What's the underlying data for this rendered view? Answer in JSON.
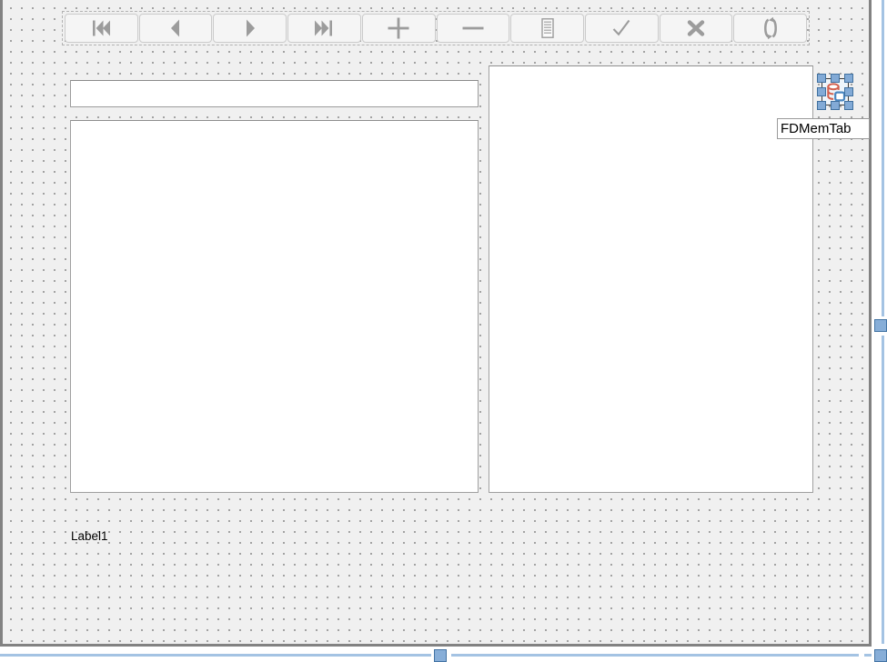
{
  "window": {
    "type": "form-designer"
  },
  "navigator": {
    "buttons": [
      {
        "id": "first",
        "icon": "first-record-icon"
      },
      {
        "id": "prior",
        "icon": "prior-record-icon"
      },
      {
        "id": "next",
        "icon": "next-record-icon"
      },
      {
        "id": "last",
        "icon": "last-record-icon"
      },
      {
        "id": "insert",
        "icon": "insert-record-icon"
      },
      {
        "id": "delete",
        "icon": "delete-record-icon"
      },
      {
        "id": "edit",
        "icon": "edit-record-icon"
      },
      {
        "id": "post",
        "icon": "post-edit-icon"
      },
      {
        "id": "cancel",
        "icon": "cancel-edit-icon"
      },
      {
        "id": "refresh",
        "icon": "refresh-icon"
      }
    ]
  },
  "edit_field": {
    "value": "",
    "placeholder": ""
  },
  "label1": {
    "text": "Label1"
  },
  "component": {
    "caption": "FDMemTab",
    "icon": "fdmemtable-icon"
  },
  "colors": {
    "form_background": "#f0f0f0",
    "grid_dot": "#949494",
    "panel_background": "#ffffff",
    "panel_border": "#a0a0a0",
    "navigator_glyph": "#9c9c9c",
    "selection_handle_fill": "#82aad6",
    "selection_handle_border": "#41719f",
    "selection_line": "#a4c3e3",
    "component_icon_red": "#d2604e",
    "component_icon_blue": "#4a86c0",
    "form_border": "#828282"
  }
}
